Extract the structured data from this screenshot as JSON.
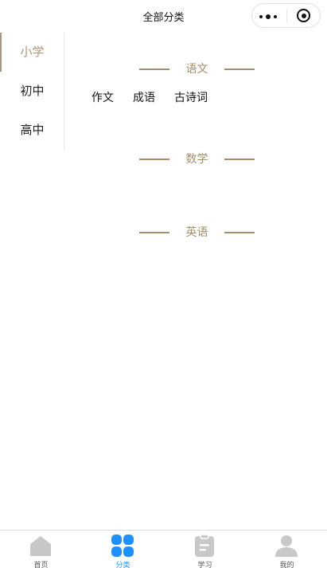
{
  "navbar": {
    "title": "全部分类"
  },
  "sidebar": {
    "items": [
      {
        "label": "小学",
        "active": true
      },
      {
        "label": "初中",
        "active": false
      },
      {
        "label": "高中",
        "active": false
      }
    ]
  },
  "sections": [
    {
      "title": "语文",
      "items": [
        "作文",
        "成语",
        "古诗词"
      ]
    },
    {
      "title": "数学",
      "items": []
    },
    {
      "title": "英语",
      "items": []
    }
  ],
  "tabbar": {
    "items": [
      {
        "label": "首页",
        "icon": "home-icon"
      },
      {
        "label": "分类",
        "icon": "category-icon",
        "active": true
      },
      {
        "label": "学习",
        "icon": "study-icon"
      },
      {
        "label": "我的",
        "icon": "profile-icon"
      }
    ]
  },
  "colors": {
    "accent": "#b0977a",
    "divider_line": "#a3906b",
    "tab_active": "#1e90ff",
    "tab_inactive": "#c8c8c8"
  }
}
